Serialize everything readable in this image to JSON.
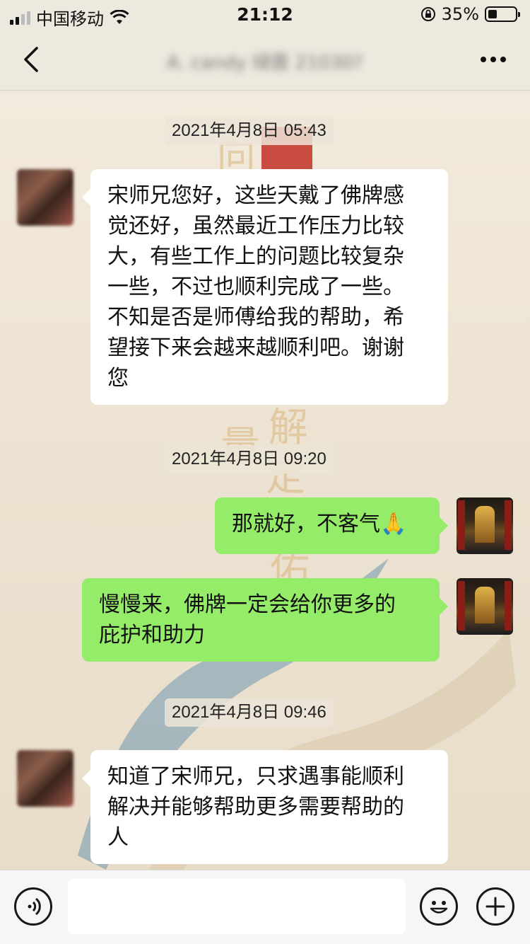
{
  "status_bar": {
    "carrier": "中国移动",
    "time": "21:12",
    "battery": "35%",
    "battery_level": 0.35,
    "icons": [
      "signal-icon",
      "wifi-icon",
      "orientation-lock-icon",
      "battery-icon"
    ]
  },
  "nav": {
    "back_icon": "chevron-left-icon",
    "title": "A. candy 绿茵 21030?",
    "more_icon": "ellipsis-icon"
  },
  "messages": [
    {
      "type": "timestamp",
      "text": "2021年4月8日 05:43"
    },
    {
      "type": "incoming",
      "text": "宋师兄您好，这些天戴了佛牌感\n觉还好，虽然最近工作压力比较\n大，有些工作上的问题比较复杂\n一些，不过也顺利完成了一些。\n不知是否是师傅给我的帮助，希\n望接下来会越来越顺利吧。谢谢\n您"
    },
    {
      "type": "timestamp",
      "text": "2021年4月8日 09:20"
    },
    {
      "type": "outgoing",
      "text": "那就好，不客气🙏"
    },
    {
      "type": "outgoing",
      "text": "慢慢来，佛牌一定会给你更多的\n庇护和助力"
    },
    {
      "type": "timestamp",
      "text": "2021年4月8日 09:46"
    },
    {
      "type": "incoming",
      "text": "知道了宋师兄，只求遇事能顺利\n解决并能够帮助更多需要帮助的\n人"
    }
  ],
  "input_bar": {
    "voice_icon": "voice-icon",
    "placeholder": "",
    "emoji_icon": "emoji-icon",
    "add_icon": "plus-icon"
  },
  "colors": {
    "outgoing_bubble": "#95ec69",
    "incoming_bubble": "#ffffff",
    "nav_background": "#ede9df"
  }
}
